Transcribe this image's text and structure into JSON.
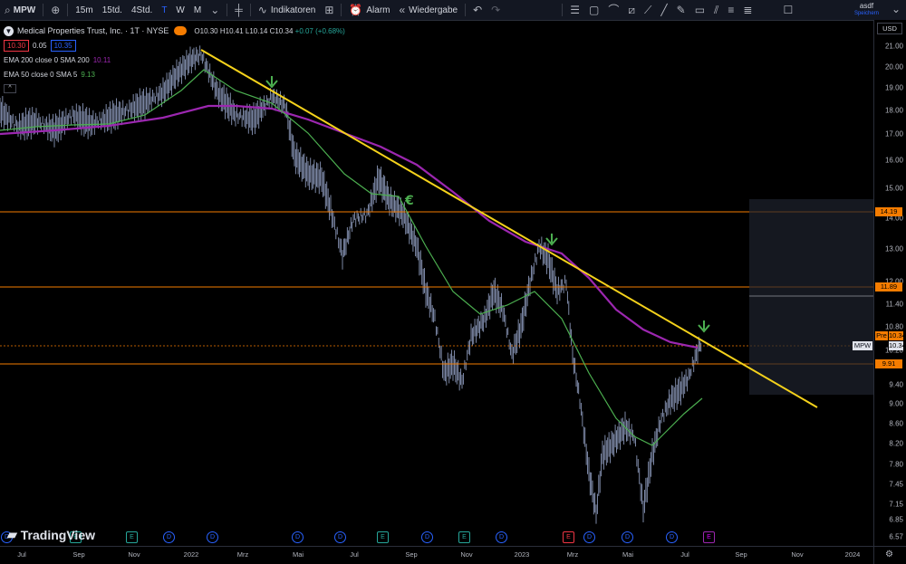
{
  "toolbar": {
    "symbol": "MPW",
    "intervals": [
      "15m",
      "15td.",
      "4Std.",
      "T",
      "W",
      "M"
    ],
    "indicators_label": "Indikatoren",
    "alarm_label": "Alarm",
    "replay_label": "Wiedergabe",
    "user_name": "asdf",
    "user_sub": "Speichern"
  },
  "legend": {
    "title": "Medical Properties Trust, Inc. · 1T · NYSE",
    "ohlc_o": "O10.30",
    "ohlc_h": "H10.41",
    "ohlc_l": "L10.14",
    "ohlc_c": "C10.34",
    "change": "+0.07 (+0.68%)",
    "bid": "10.30",
    "spread": "0.05",
    "ask": "10.35",
    "ema200_label": "EMA 200 close 0 SMA 200",
    "ema200_value": "10.11",
    "ema50_label": "EMA 50 close 0 SMA 5",
    "ema50_value": "9.13"
  },
  "price_axis": {
    "currency": "USD",
    "ticks": [
      "21.00",
      "20.00",
      "19.00",
      "18.00",
      "17.00",
      "16.00",
      "15.00",
      "14.00",
      "13.00",
      "12.00",
      "11.40",
      "10.80",
      "10.20",
      "9.40",
      "9.00",
      "8.60",
      "8.20",
      "7.80",
      "7.45",
      "7.15",
      "6.85",
      "6.57"
    ],
    "labels": {
      "h1": "14.19",
      "h2": "11.89",
      "pre_tag": "Pre",
      "pre_price": "10.34",
      "sym_tag": "MPW",
      "last": "10.34",
      "h3": "9.91"
    }
  },
  "time_axis": [
    "Jul",
    "Sep",
    "Nov",
    "2022",
    "Mrz",
    "Mai",
    "Jul",
    "Sep",
    "Nov",
    "2023",
    "Mrz",
    "Mai",
    "Jul",
    "Sep",
    "Nov",
    "2024"
  ],
  "events": [
    "D",
    "E",
    "D",
    "E",
    "D",
    "E",
    "D",
    "E",
    "D",
    "E",
    "D",
    "E",
    "E",
    "D",
    "E",
    "D",
    "E"
  ],
  "watermark": "TradingView",
  "colors": {
    "ema200": "#9c27b0",
    "ema50": "#4caf50",
    "trendline": "#f5d21b",
    "hline": "#f57c00",
    "candle": "#8a97b8",
    "arrow": "#4caf50"
  }
}
